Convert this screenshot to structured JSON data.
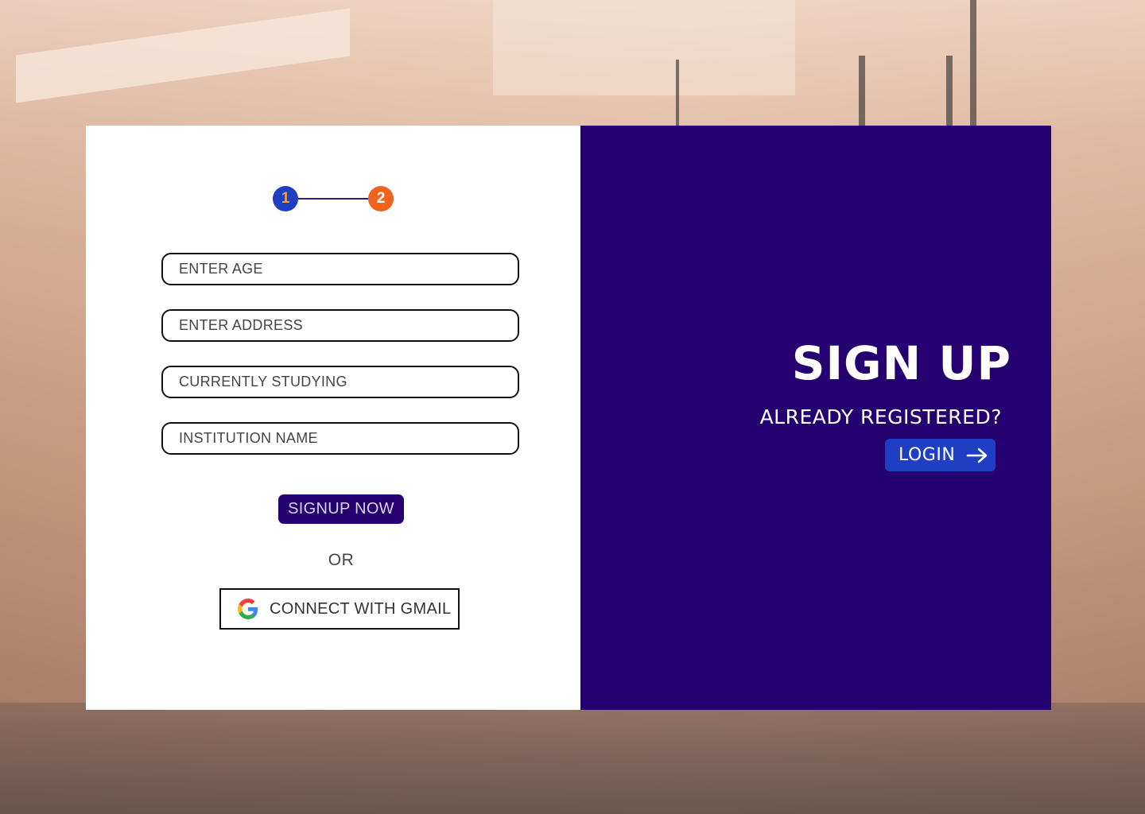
{
  "stepper": {
    "steps": [
      "1",
      "2"
    ]
  },
  "form": {
    "fields": [
      {
        "placeholder": "ENTER AGE"
      },
      {
        "placeholder": "ENTER ADDRESS"
      },
      {
        "placeholder": "CURRENTLY STUDYING"
      },
      {
        "placeholder": "INSTITUTION NAME"
      }
    ],
    "submit_label": "SIGNUP NOW",
    "divider_text": "OR",
    "gmail_label": "CONNECT WITH GMAIL"
  },
  "panel": {
    "title": "SIGN UP",
    "subtitle": "ALREADY REGISTERED?",
    "login_label": "LOGIN"
  },
  "colors": {
    "panel_bg": "#250070",
    "step_active": "#1e3fc4",
    "step_next": "#f0641e",
    "login_bg": "#1e3fc4"
  },
  "icons": [
    "google-icon",
    "arrow-right-icon"
  ]
}
